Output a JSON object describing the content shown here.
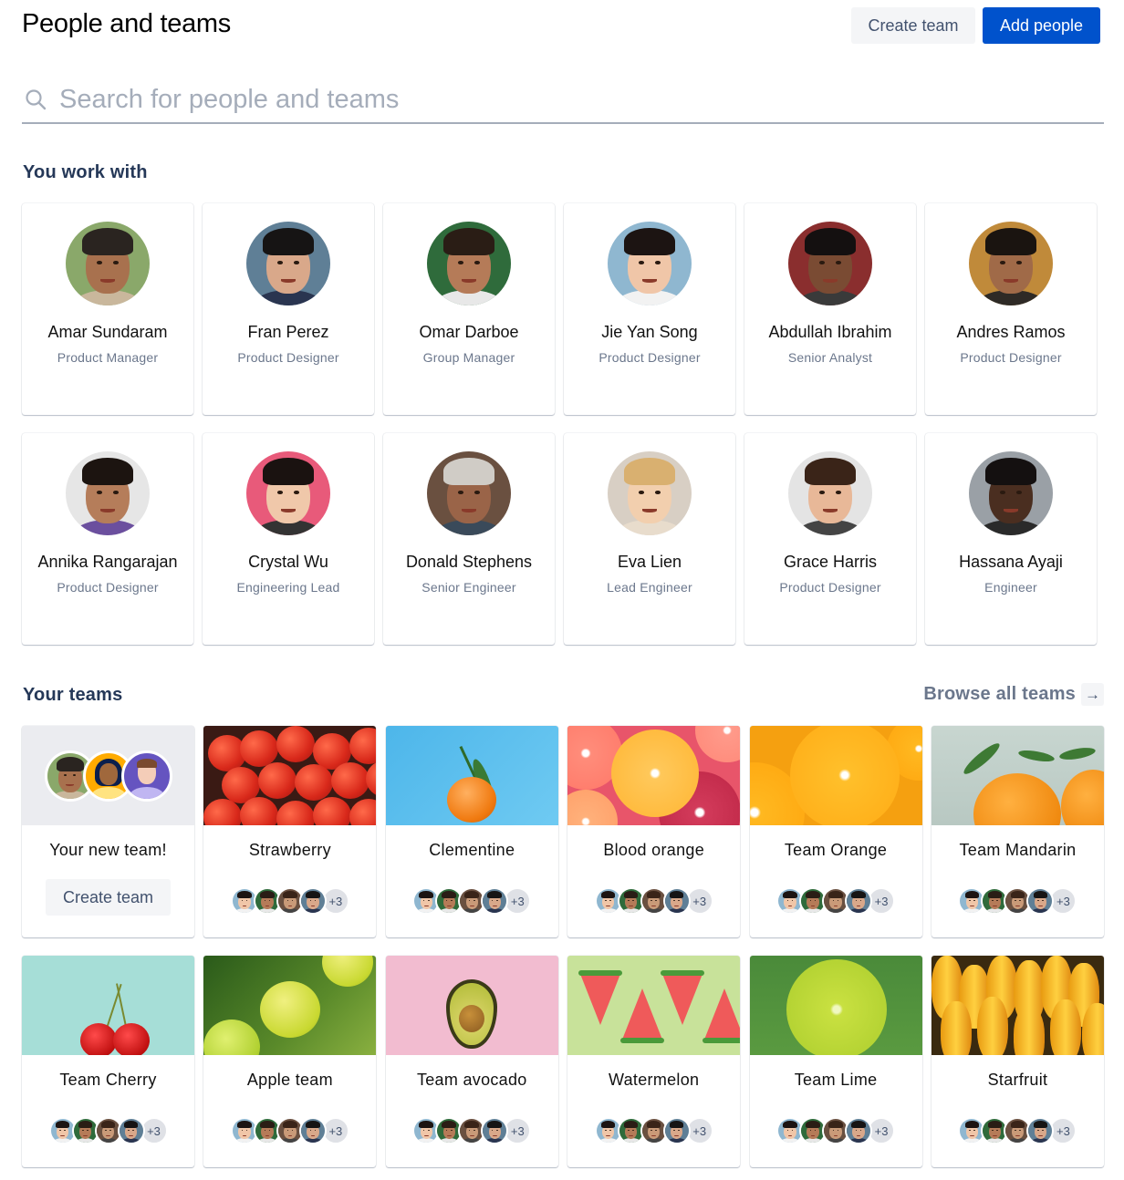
{
  "header": {
    "title": "People and teams",
    "create_team_label": "Create team",
    "add_people_label": "Add people"
  },
  "search": {
    "placeholder": "Search for people and teams",
    "value": ""
  },
  "colors": {
    "primary": "#0052CC",
    "secondary_button_bg": "#F4F5F7",
    "section_title": "#253858",
    "subtle_text": "#6B778C",
    "search_border": "#A5ADBA"
  },
  "people_section": {
    "title": "You work with",
    "people": [
      {
        "name": "Amar Sundaram",
        "role": "Product Manager",
        "avatar": {
          "bg": "#8aa86a",
          "skin": "#a8714e",
          "hair": "#2a2420",
          "shirt": "#c9b79c"
        }
      },
      {
        "name": "Fran Perez",
        "role": "Product Designer",
        "avatar": {
          "bg": "#5f7f96",
          "skin": "#d9a88a",
          "hair": "#161414",
          "shirt": "#2a3550"
        }
      },
      {
        "name": "Omar Darboe",
        "role": "Group Manager",
        "avatar": {
          "bg": "#2f6b3b",
          "skin": "#b57b58",
          "hair": "#2a1d15",
          "shirt": "#e8e8e8"
        }
      },
      {
        "name": "Jie Yan Song",
        "role": "Product Designer",
        "avatar": {
          "bg": "#8fb7d0",
          "skin": "#f0c6a8",
          "hair": "#1c1412",
          "shirt": "#f2f2f2"
        }
      },
      {
        "name": "Abdullah Ibrahim",
        "role": "Senior Analyst",
        "avatar": {
          "bg": "#8a2e2e",
          "skin": "#7a4b33",
          "hair": "#141010",
          "shirt": "#3a3a3a"
        }
      },
      {
        "name": "Andres Ramos",
        "role": "Product Designer",
        "avatar": {
          "bg": "#c08a3a",
          "skin": "#a06a48",
          "hair": "#1a1410",
          "shirt": "#2e2a26"
        }
      },
      {
        "name": "Annika Rangarajan",
        "role": "Product Designer",
        "avatar": {
          "bg": "#e6e6e6",
          "skin": "#b57d5a",
          "hair": "#1c1410",
          "shirt": "#6b4f9e"
        }
      },
      {
        "name": "Crystal Wu",
        "role": "Engineering Lead",
        "avatar": {
          "bg": "#e85a7a",
          "skin": "#f0c8aa",
          "hair": "#1a1210",
          "shirt": "#333"
        }
      },
      {
        "name": "Donald Stephens",
        "role": "Senior Engineer",
        "avatar": {
          "bg": "#6a5040",
          "skin": "#9a6448",
          "hair": "#d0ccc6",
          "shirt": "#3a4a5a"
        }
      },
      {
        "name": "Eva Lien",
        "role": "Lead Engineer",
        "avatar": {
          "bg": "#d8cfc4",
          "skin": "#f2cfae",
          "hair": "#d9b070",
          "shirt": "#e8dccc"
        }
      },
      {
        "name": "Grace Harris",
        "role": "Product Designer",
        "avatar": {
          "bg": "#e4e4e4",
          "skin": "#e8b898",
          "hair": "#3a2418",
          "shirt": "#444"
        }
      },
      {
        "name": "Hassana Ayaji",
        "role": "Engineer",
        "avatar": {
          "bg": "#9aa0a6",
          "skin": "#4a2e20",
          "hair": "#141010",
          "shirt": "#2a2a2a"
        }
      }
    ]
  },
  "teams_section": {
    "title": "Your teams",
    "browse_all_label": "Browse all teams",
    "new_team": {
      "name": "Your new team!",
      "create_label": "Create team"
    },
    "teams": [
      {
        "name": "Strawberry",
        "image": "strawberries",
        "extra_members": "+3"
      },
      {
        "name": "Clementine",
        "image": "clementine",
        "extra_members": "+3"
      },
      {
        "name": "Blood orange",
        "image": "blood-orange-slices",
        "extra_members": "+3"
      },
      {
        "name": "Team Orange",
        "image": "orange-slices",
        "extra_members": "+3"
      },
      {
        "name": "Team Mandarin",
        "image": "mandarins",
        "extra_members": "+3"
      },
      {
        "name": "Team Cherry",
        "image": "cherries",
        "extra_members": "+3"
      },
      {
        "name": "Apple team",
        "image": "green-apples",
        "extra_members": "+3"
      },
      {
        "name": "Team avocado",
        "image": "avocado",
        "extra_members": "+3"
      },
      {
        "name": "Watermelon",
        "image": "watermelon-slices",
        "extra_members": "+3"
      },
      {
        "name": "Team Lime",
        "image": "lime",
        "extra_members": "+3"
      },
      {
        "name": "Starfruit",
        "image": "starfruit",
        "extra_members": "+3"
      }
    ],
    "member_avatars": [
      {
        "bg": "#8fb7d0",
        "skin": "#f0c6a8",
        "hair": "#1c1412",
        "shirt": "#f2f2f2"
      },
      {
        "bg": "#2f6b3b",
        "skin": "#b57b58",
        "hair": "#2a1d15",
        "shirt": "#e8e8e8"
      },
      {
        "bg": "#6a5040",
        "skin": "#c99a78",
        "hair": "#3a2418",
        "shirt": "#444"
      },
      {
        "bg": "#5f7f96",
        "skin": "#d9a88a",
        "hair": "#161414",
        "shirt": "#2a3550"
      }
    ]
  }
}
